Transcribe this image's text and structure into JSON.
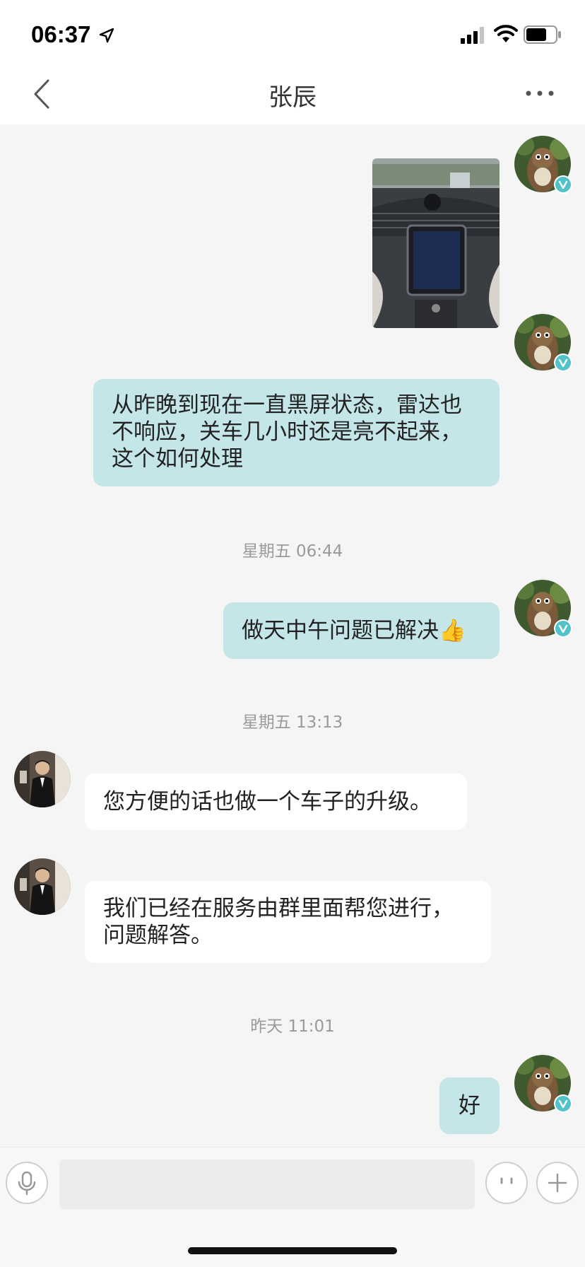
{
  "status_bar": {
    "time": "06:37"
  },
  "nav": {
    "title": "张辰"
  },
  "messages": {
    "m2": "从昨晚到现在一直黑屏状态，雷达也不响应，关车几小时还是亮不起来，这个如何处理",
    "ts1": "星期五 06:44",
    "m3": "做天中午问题已解决👍",
    "ts2": "星期五 13:13",
    "m4": "您方便的话也做一个车子的升级。",
    "m5": "我们已经在服务由群里面帮您进行，问题解答。",
    "ts3": "昨天 11:01",
    "m6": "好"
  },
  "colors": {
    "mine_bubble": "#c4e6e9",
    "theirs_bubble": "#ffffff",
    "verified_badge": "#4fc3c8",
    "background": "#f5f5f5"
  },
  "icons": {
    "back": "chevron-left-icon",
    "more": "more-dots-icon",
    "mic": "microphone-icon",
    "emoji": "emoji-face-icon",
    "plus": "plus-icon",
    "verified": "verified-v-icon"
  }
}
